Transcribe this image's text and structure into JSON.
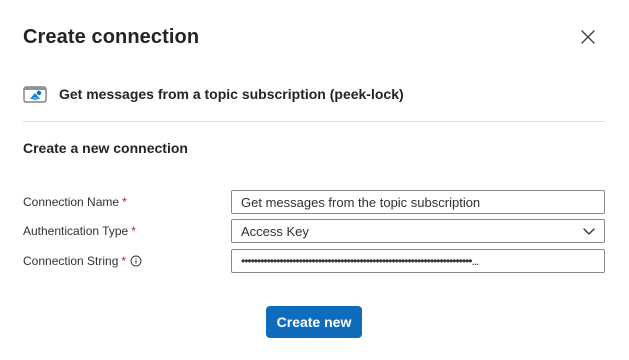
{
  "dialog": {
    "title": "Create connection",
    "close_icon": "close-icon"
  },
  "action": {
    "icon": "service-bus-icon",
    "label": "Get messages from a topic subscription (peek-lock)"
  },
  "section": {
    "title": "Create a new connection"
  },
  "fields": {
    "connection_name": {
      "label": "Connection Name",
      "required": "*",
      "value": "Get messages from the topic subscription"
    },
    "auth_type": {
      "label": "Authentication Type",
      "required": "*",
      "value": "Access Key",
      "icon": "chevron-down-icon"
    },
    "connection_string": {
      "label": "Connection String",
      "required": "*",
      "info_icon": "info-icon",
      "value": "••••••••••••••••••••••••••••••••••••••••••••••••••••••••••••••••••••••••...",
      "masked": true
    }
  },
  "buttons": {
    "create_label": "Create new"
  },
  "colors": {
    "primary": "#0f6cbd",
    "required": "#a4262c",
    "border": "#8a8886",
    "divider": "#e1dfdd"
  }
}
